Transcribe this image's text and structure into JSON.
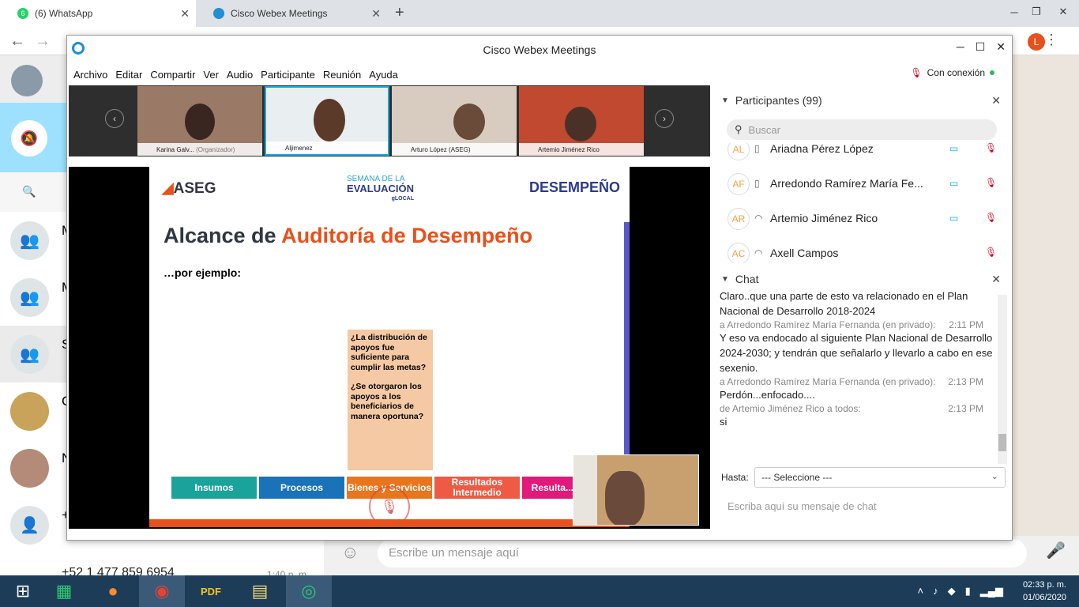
{
  "browser": {
    "tabs": [
      {
        "title": "(6) WhatsApp",
        "badge": "6"
      },
      {
        "title": "Cisco Webex Meetings"
      }
    ],
    "profile_initial": "L"
  },
  "whatsapp": {
    "rows": [
      {
        "initial": "M"
      },
      {
        "initial": "M"
      },
      {
        "initial": "S"
      },
      {
        "initial": "C"
      },
      {
        "initial": "N"
      },
      {
        "initial": "+"
      }
    ],
    "last_contact": "+52 1 477 859 6954",
    "last_time": "1:40 p. m.",
    "message_placeholder": "Escribe un mensaje aquí"
  },
  "webex": {
    "window_title": "Cisco Webex Meetings",
    "menu": [
      "Archivo",
      "Editar",
      "Compartir",
      "Ver",
      "Audio",
      "Participante",
      "Reunión",
      "Ayuda"
    ],
    "connection": "Con conexión",
    "video_thumbs": [
      {
        "name": "Karina  Galv...",
        "role": "(Organizador)"
      },
      {
        "name": "Aljimenez",
        "role": ""
      },
      {
        "name": "Arturo López (ASEG)",
        "role": ""
      },
      {
        "name": "Artemio Jiménez Rico",
        "role": ""
      }
    ],
    "slide": {
      "logo_left": "ASEG",
      "logo_center_1": "SEMANA DE LA",
      "logo_center_2": "EVALUACIÓN",
      "logo_center_3": "gLOCAL",
      "logo_right": "DESEMPEÑO",
      "title_part1": "Alcance de",
      "title_part2": "Auditoría de Desempeño",
      "subtitle": "…por ejemplo:",
      "box_q1": "¿La distribución de apoyos fue suficiente para cumplir las metas?",
      "box_q2": "¿Se otorgaron los apoyos a los beneficiarios de manera oportuna?",
      "categories": [
        {
          "label": "Insumos",
          "color": "#1aa39a"
        },
        {
          "label": "Procesos",
          "color": "#1a72b8"
        },
        {
          "label": "Bienes y Servicios",
          "color": "#e8761c"
        },
        {
          "label": "Resultados Intermedio",
          "color": "#ee5a44"
        },
        {
          "label": "Resulta... Final",
          "color": "#e0197a"
        }
      ]
    },
    "participants": {
      "header": "Participantes (99)",
      "search_placeholder": "Buscar",
      "list": [
        {
          "initials": "AL",
          "name": "Ariadna Pérez López"
        },
        {
          "initials": "AF",
          "name": "Arredondo Ramírez María Fe..."
        },
        {
          "initials": "AR",
          "name": "Artemio Jiménez Rico"
        },
        {
          "initials": "AC",
          "name": "Axell Campos"
        }
      ]
    },
    "chat": {
      "header": "Chat",
      "messages": [
        {
          "text": "Claro..que una parte de esto va relacionado en el Plan Nacional de Desarrollo 2018-2024",
          "meta": "a Arredondo Ramírez María Fernanda (en privado):",
          "time": "2:11 PM"
        },
        {
          "text": "Y eso va endocado al siguiente Plan Nacional de Desarrollo 2024-2030; y tendrán que señalarlo y llevarlo a cabo en ese sexenio.",
          "meta": "a Arredondo Ramírez María Fernanda (en privado):",
          "time": "2:13 PM"
        },
        {
          "text": "Perdón...enfocado....",
          "meta": "de Artemio Jiménez Rico a todos:",
          "time": "2:13 PM"
        },
        {
          "text": "si",
          "meta": "",
          "time": ""
        }
      ],
      "to_label": "Hasta:",
      "to_value": "--- Seleccione ---",
      "input_placeholder": "Escriba aquí su mensaje de chat"
    }
  },
  "taskbar": {
    "time": "02:33 p. m.",
    "date": "01/06/2020"
  },
  "colors": {
    "accent_orange": "#e8501c",
    "webex_blue": "#19a9e5",
    "mute_red": "#d0021b"
  }
}
